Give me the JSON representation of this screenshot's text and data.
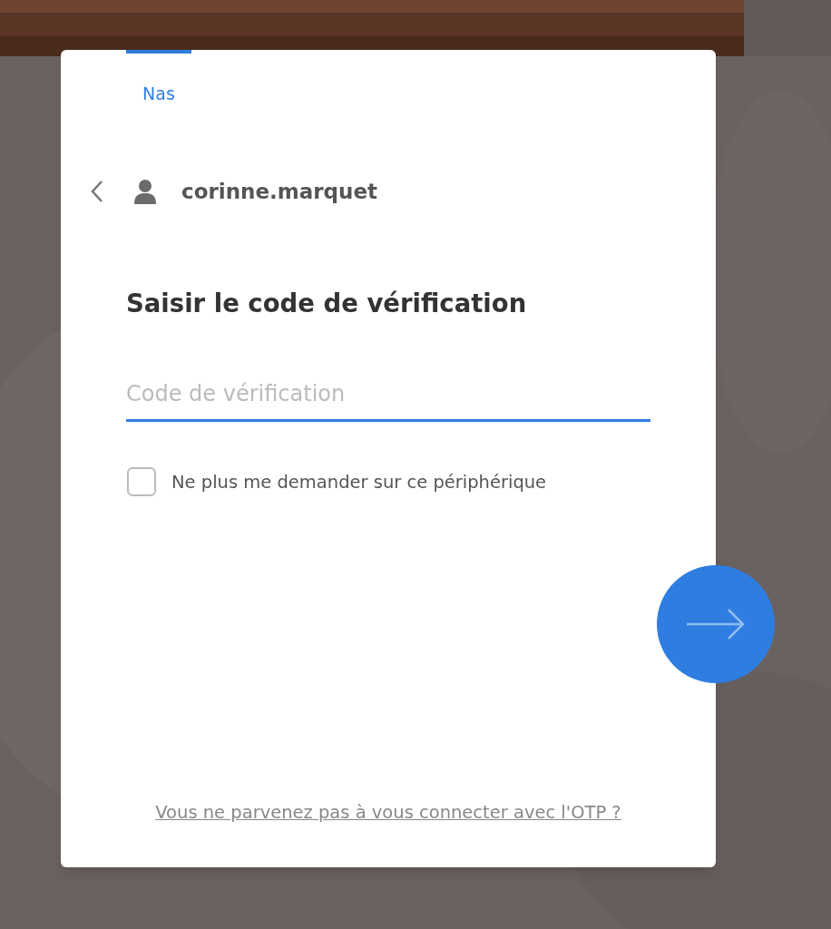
{
  "tabs": [
    {
      "label": "Nas",
      "selected": true
    }
  ],
  "account": {
    "username": "corinne.marquet"
  },
  "heading": "Saisir le code de vérification",
  "code_field": {
    "placeholder": "Code de vérification",
    "focused": true
  },
  "remember_device": {
    "label": "Ne plus me demander sur ce périphérique",
    "checked": false
  },
  "otp_help_link": "Vous ne parvenez pas à vous connecter avec l'OTP ?"
}
